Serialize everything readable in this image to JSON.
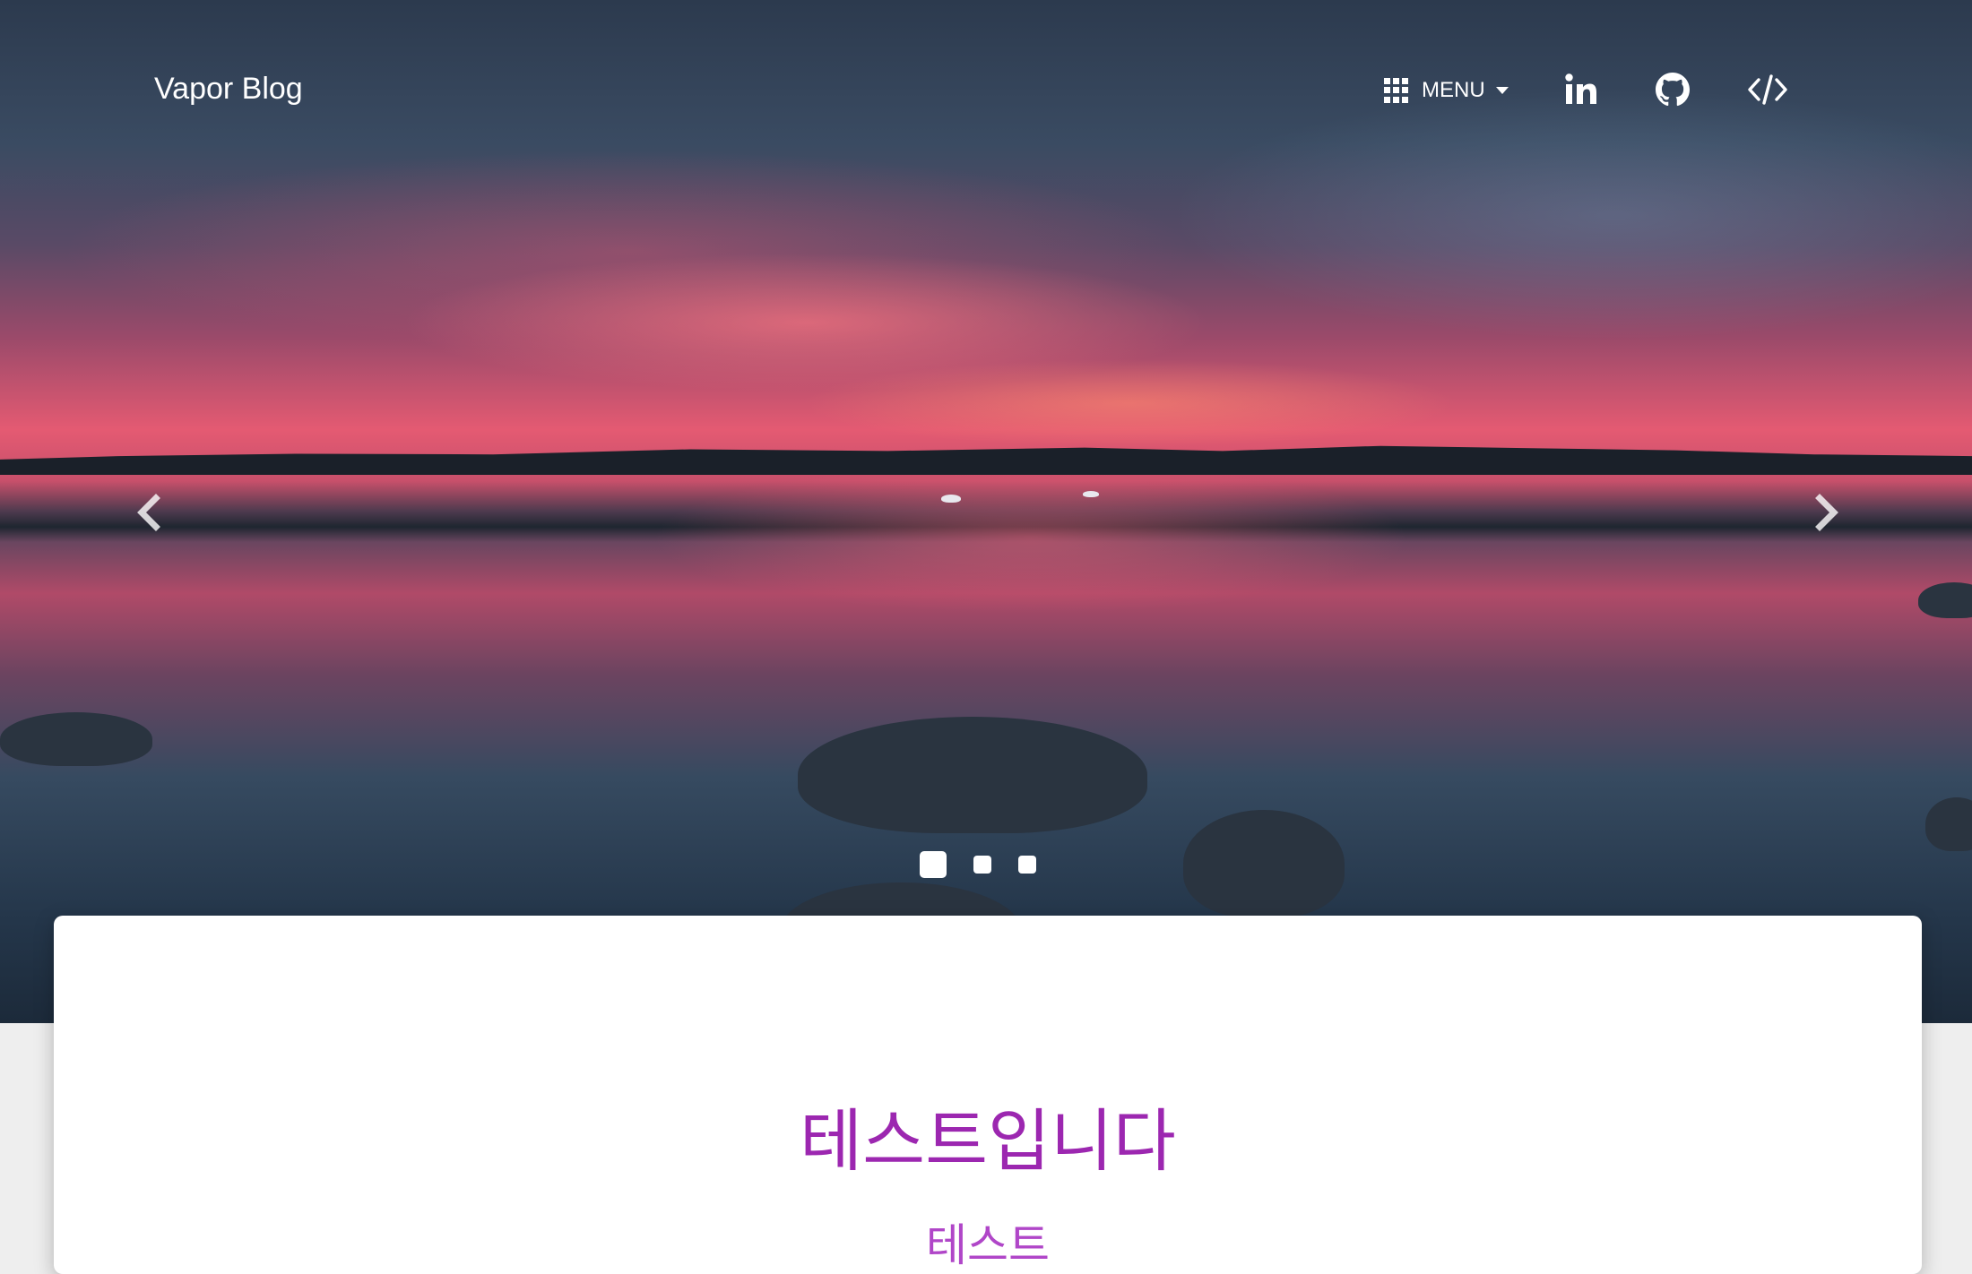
{
  "header": {
    "brand": "Vapor Blog",
    "menu_label": "MENU",
    "icons": [
      "grid-icon",
      "linkedin-icon",
      "github-icon",
      "code-icon"
    ]
  },
  "carousel": {
    "slide_count": 3,
    "active_slide": 1,
    "prev_icon": "chevron-left-icon",
    "next_icon": "chevron-right-icon"
  },
  "post": {
    "title": "테스트입니다",
    "subtitle": "테스트"
  },
  "colors": {
    "accent": "#9c27b0",
    "page_background": "#eeeeee",
    "card_background": "#ffffff"
  }
}
